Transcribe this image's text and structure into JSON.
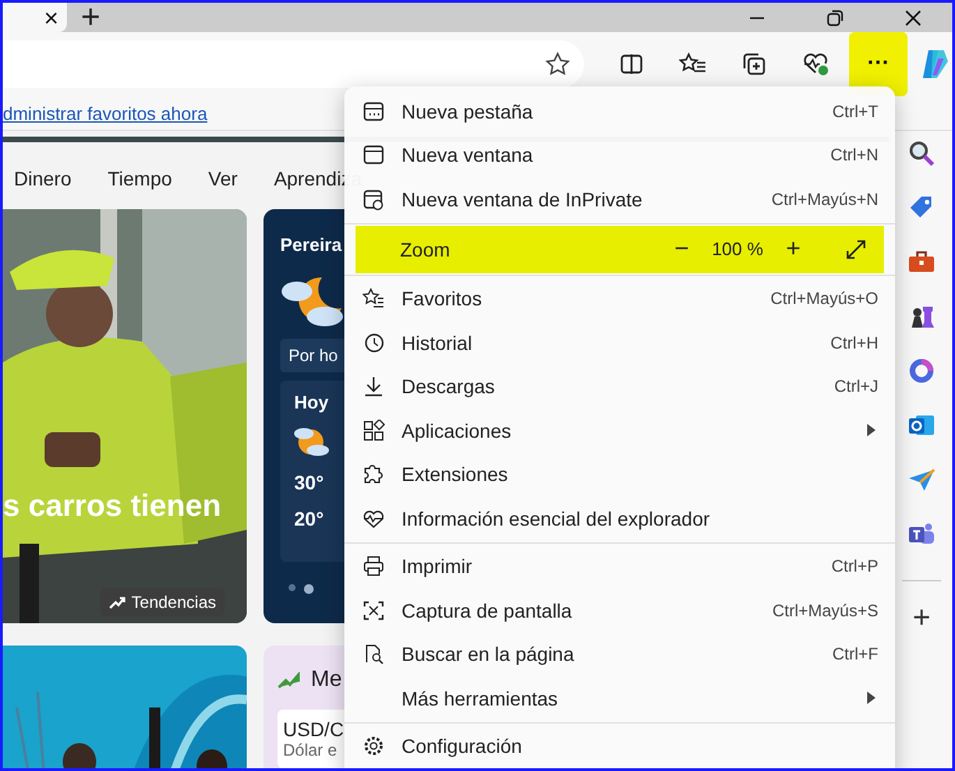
{
  "tab": {
    "close": "×"
  },
  "new_tab": "+",
  "toolbar": {
    "more": {
      "label": "···",
      "highlighted": true
    }
  },
  "favorites_bar": {
    "link": "dministrar favoritos ahora"
  },
  "nav": [
    "Dinero",
    "Tiempo",
    "Ver",
    "Aprendiza"
  ],
  "hero": {
    "headline": "s carros tienen",
    "badge": "Tendencias"
  },
  "weather": {
    "city": "Pereira",
    "tab": "Por ho",
    "day": "Hoy",
    "high": "30°",
    "low": "20°",
    "dots": [
      {
        "selected": false
      },
      {
        "selected": true
      }
    ]
  },
  "markets": {
    "title": "Me",
    "pair": "USD/C",
    "desc": "Dólar e"
  },
  "menu": [
    {
      "kind": "item",
      "label": "Nueva pestaña",
      "shortcut": "Ctrl+T"
    },
    {
      "kind": "item",
      "label": "Nueva ventana",
      "shortcut": "Ctrl+N"
    },
    {
      "kind": "item",
      "label": "Nueva ventana de InPrivate",
      "shortcut": "Ctrl+Mayús+N"
    },
    {
      "kind": "divider"
    },
    {
      "kind": "zoom",
      "label": "Zoom",
      "minus": "−",
      "value": "100 %",
      "plus": "+",
      "highlighted": true
    },
    {
      "kind": "divider"
    },
    {
      "kind": "item",
      "label": "Favoritos",
      "shortcut": "Ctrl+Mayús+O"
    },
    {
      "kind": "item",
      "label": "Historial",
      "shortcut": "Ctrl+H"
    },
    {
      "kind": "item",
      "label": "Descargas",
      "shortcut": "Ctrl+J"
    },
    {
      "kind": "item",
      "label": "Aplicaciones",
      "submenu": true
    },
    {
      "kind": "item",
      "label": "Extensiones"
    },
    {
      "kind": "item",
      "label": "Información esencial del explorador"
    },
    {
      "kind": "divider"
    },
    {
      "kind": "item",
      "label": "Imprimir",
      "shortcut": "Ctrl+P"
    },
    {
      "kind": "item",
      "label": "Captura de pantalla",
      "shortcut": "Ctrl+Mayús+S"
    },
    {
      "kind": "item",
      "label": "Buscar en la página",
      "shortcut": "Ctrl+F"
    },
    {
      "kind": "item",
      "label": "Más herramientas",
      "submenu": true
    },
    {
      "kind": "divider"
    },
    {
      "kind": "item",
      "label": "Configuración"
    }
  ],
  "sidebar_add": "+"
}
